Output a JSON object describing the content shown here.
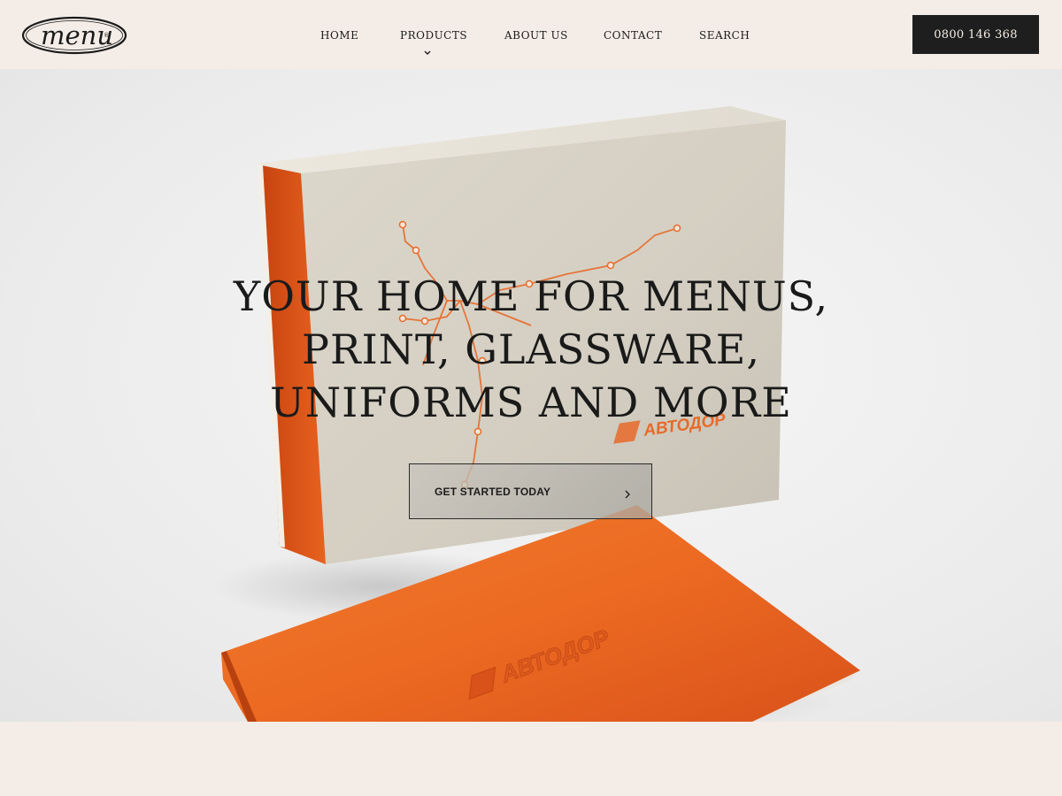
{
  "brand": {
    "logo_text": "menu",
    "logo_mark": "®"
  },
  "nav": {
    "home": "HOME",
    "products": "PRODUCTS",
    "about": "ABOUT US",
    "contact": "CONTACT",
    "search": "SEARCH"
  },
  "header": {
    "phone": "0800 146 368"
  },
  "hero": {
    "headline_lines": [
      "YOUR HOME FOR MENUS,",
      "PRINT, GLASSWARE,",
      "UNIFORMS AND MORE"
    ],
    "cta_label": "GET STARTED TODAY",
    "product_brand_text": "АВТОДОР"
  },
  "colors": {
    "accent_orange": "#e8551c",
    "dark": "#1e1e1e",
    "cream": "#f4ede7"
  },
  "icons": {
    "dropdown": "chevron-down-icon",
    "cta": "chevron-right-icon"
  }
}
